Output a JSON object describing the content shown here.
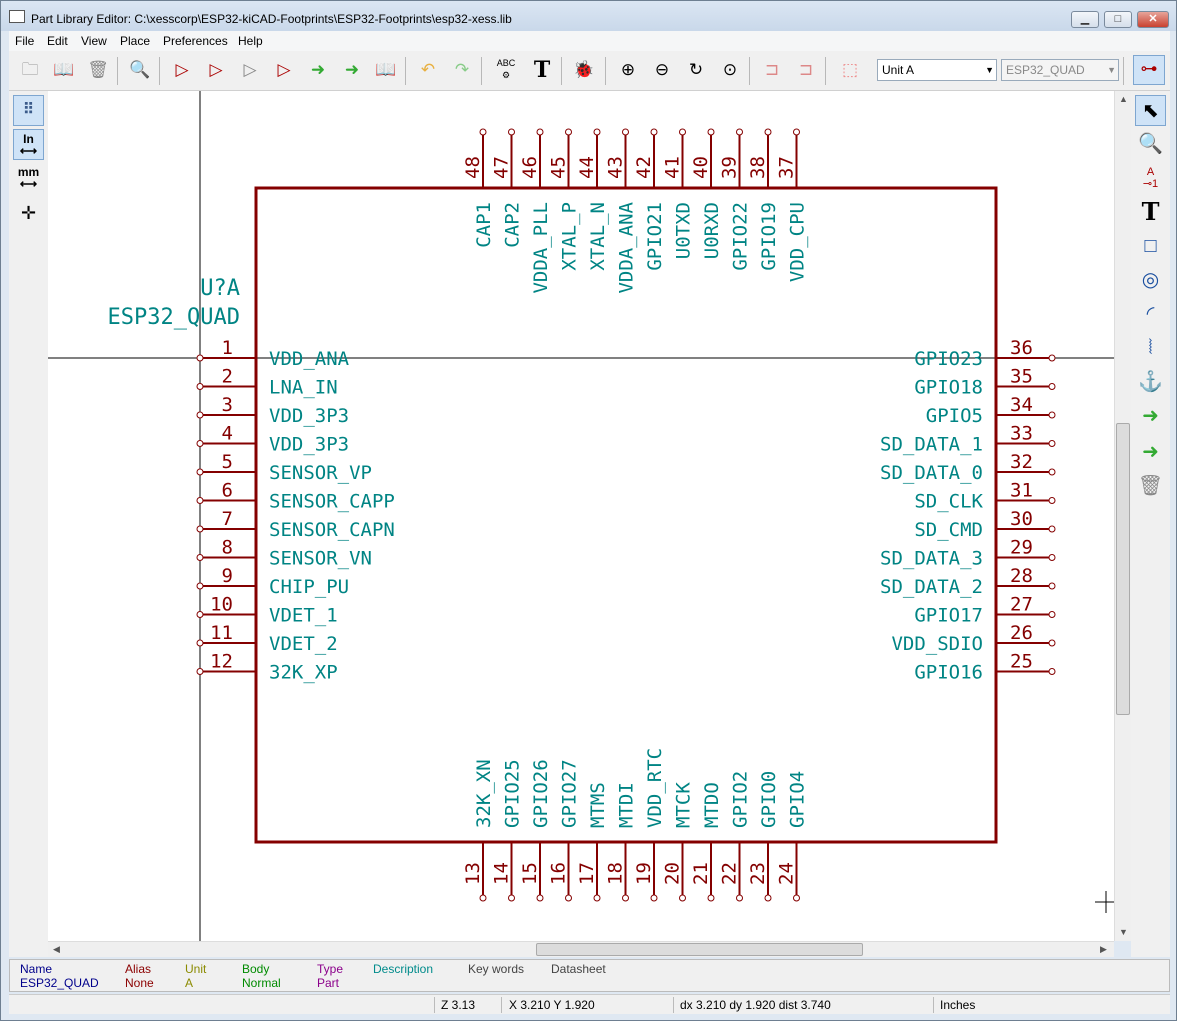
{
  "window": {
    "title": "Part Library Editor: C:\\xesscorp\\ESP32-kiCAD-Footprints\\ESP32-Footprints\\esp32-xess.lib",
    "buttons": {
      "minimize": "▁",
      "maximize": "□",
      "close": "✕"
    }
  },
  "menu": [
    "File",
    "Edit",
    "View",
    "Place",
    "Preferences",
    "Help"
  ],
  "toolbar": {
    "unit_select": "Unit A",
    "part_select": "ESP32_QUAD",
    "abc_label": "ABC",
    "text_tool": "T"
  },
  "left_toolbar": {
    "inch_label": "In",
    "mm_label": "mm"
  },
  "right_toolbar": {
    "pin_label": "A",
    "pin_number": "1",
    "text_tool": "T"
  },
  "component": {
    "reference": "U?A",
    "value": "ESP32_QUAD",
    "colors": {
      "body": "#840000",
      "pin_name": "#008484",
      "pin_number": "#840000",
      "field": "#008484"
    },
    "left_pins": [
      {
        "num": "1",
        "name": "VDD_ANA"
      },
      {
        "num": "2",
        "name": "LNA_IN"
      },
      {
        "num": "3",
        "name": "VDD_3P3"
      },
      {
        "num": "4",
        "name": "VDD_3P3"
      },
      {
        "num": "5",
        "name": "SENSOR_VP"
      },
      {
        "num": "6",
        "name": "SENSOR_CAPP"
      },
      {
        "num": "7",
        "name": "SENSOR_CAPN"
      },
      {
        "num": "8",
        "name": "SENSOR_VN"
      },
      {
        "num": "9",
        "name": "CHIP_PU"
      },
      {
        "num": "10",
        "name": "VDET_1"
      },
      {
        "num": "11",
        "name": "VDET_2"
      },
      {
        "num": "12",
        "name": "32K_XP"
      }
    ],
    "right_pins": [
      {
        "num": "36",
        "name": "GPIO23"
      },
      {
        "num": "35",
        "name": "GPIO18"
      },
      {
        "num": "34",
        "name": "GPIO5"
      },
      {
        "num": "33",
        "name": "SD_DATA_1"
      },
      {
        "num": "32",
        "name": "SD_DATA_0"
      },
      {
        "num": "31",
        "name": "SD_CLK"
      },
      {
        "num": "30",
        "name": "SD_CMD"
      },
      {
        "num": "29",
        "name": "SD_DATA_3"
      },
      {
        "num": "28",
        "name": "SD_DATA_2"
      },
      {
        "num": "27",
        "name": "GPIO17"
      },
      {
        "num": "26",
        "name": "VDD_SDIO"
      },
      {
        "num": "25",
        "name": "GPIO16"
      }
    ],
    "top_pins": [
      {
        "num": "48",
        "name": "CAP1"
      },
      {
        "num": "47",
        "name": "CAP2"
      },
      {
        "num": "46",
        "name": "VDDA_PLL"
      },
      {
        "num": "45",
        "name": "XTAL_P"
      },
      {
        "num": "44",
        "name": "XTAL_N"
      },
      {
        "num": "43",
        "name": "VDDA_ANA"
      },
      {
        "num": "42",
        "name": "GPIO21"
      },
      {
        "num": "41",
        "name": "U0TXD"
      },
      {
        "num": "40",
        "name": "U0RXD"
      },
      {
        "num": "39",
        "name": "GPIO22"
      },
      {
        "num": "38",
        "name": "GPIO19"
      },
      {
        "num": "37",
        "name": "VDD_CPU"
      }
    ],
    "bottom_pins": [
      {
        "num": "13",
        "name": "32K_XN"
      },
      {
        "num": "14",
        "name": "GPIO25"
      },
      {
        "num": "15",
        "name": "GPIO26"
      },
      {
        "num": "16",
        "name": "GPIO27"
      },
      {
        "num": "17",
        "name": "MTMS"
      },
      {
        "num": "18",
        "name": "MTDI"
      },
      {
        "num": "19",
        "name": "VDD_RTC"
      },
      {
        "num": "20",
        "name": "MTCK"
      },
      {
        "num": "21",
        "name": "MTDO"
      },
      {
        "num": "22",
        "name": "GPIO2"
      },
      {
        "num": "23",
        "name": "GPIO0"
      },
      {
        "num": "24",
        "name": "GPIO4"
      }
    ]
  },
  "info_panel": [
    {
      "header": "Name",
      "value": "ESP32_QUAD",
      "color": "#00008b"
    },
    {
      "header": "Alias",
      "value": "None",
      "color": "#8b0000"
    },
    {
      "header": "Unit",
      "value": "A",
      "color": "#8b8b00"
    },
    {
      "header": "Body",
      "value": "Normal",
      "color": "#008b00"
    },
    {
      "header": "Type",
      "value": "Part",
      "color": "#8b008b"
    },
    {
      "header": "Description",
      "value": "",
      "color": "#008b8b"
    },
    {
      "header": "Key words",
      "value": "",
      "color": "#444444"
    },
    {
      "header": "Datasheet",
      "value": "",
      "color": "#444444"
    }
  ],
  "status": {
    "zoom": "Z 3.13",
    "cursor": "X 3.210  Y 1.920",
    "delta": "dx 3.210  dy 1.920  dist 3.740",
    "units": "Inches"
  }
}
